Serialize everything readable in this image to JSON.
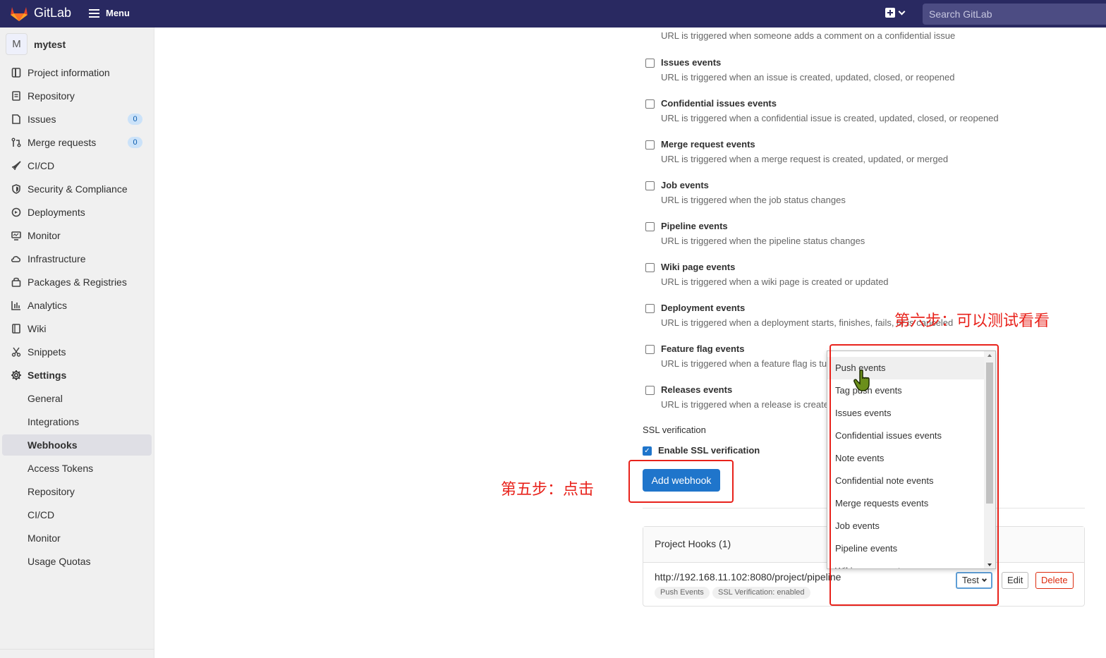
{
  "header": {
    "brand": "GitLab",
    "menu_label": "Menu",
    "search_placeholder": "Search GitLab"
  },
  "colors": {
    "topbar": "#292961",
    "primary": "#1f75cb",
    "danger": "#dd2b0e",
    "annotation": "#e8221b"
  },
  "sidebar": {
    "project_initial": "M",
    "project_name": "mytest",
    "items": [
      {
        "label": "Project information",
        "icon": "info-icon"
      },
      {
        "label": "Repository",
        "icon": "repository-icon"
      },
      {
        "label": "Issues",
        "icon": "issues-icon",
        "count": "0"
      },
      {
        "label": "Merge requests",
        "icon": "merge-request-icon",
        "count": "0"
      },
      {
        "label": "CI/CD",
        "icon": "rocket-icon"
      },
      {
        "label": "Security & Compliance",
        "icon": "shield-icon"
      },
      {
        "label": "Deployments",
        "icon": "deployments-icon"
      },
      {
        "label": "Monitor",
        "icon": "monitor-icon"
      },
      {
        "label": "Infrastructure",
        "icon": "cloud-icon"
      },
      {
        "label": "Packages & Registries",
        "icon": "package-icon"
      },
      {
        "label": "Analytics",
        "icon": "chart-icon"
      },
      {
        "label": "Wiki",
        "icon": "book-icon"
      },
      {
        "label": "Snippets",
        "icon": "scissors-icon"
      },
      {
        "label": "Settings",
        "icon": "gear-icon"
      }
    ],
    "settings_sub": [
      "General",
      "Integrations",
      "Webhooks",
      "Access Tokens",
      "Repository",
      "CI/CD",
      "Monitor",
      "Usage Quotas"
    ]
  },
  "events": {
    "partial_desc": "URL is triggered when someone adds a comment on a confidential issue",
    "items": [
      {
        "title": "Issues events",
        "desc": "URL is triggered when an issue is created, updated, closed, or reopened"
      },
      {
        "title": "Confidential issues events",
        "desc": "URL is triggered when a confidential issue is created, updated, closed, or reopened"
      },
      {
        "title": "Merge request events",
        "desc": "URL is triggered when a merge request is created, updated, or merged"
      },
      {
        "title": "Job events",
        "desc": "URL is triggered when the job status changes"
      },
      {
        "title": "Pipeline events",
        "desc": "URL is triggered when the pipeline status changes"
      },
      {
        "title": "Wiki page events",
        "desc": "URL is triggered when a wiki page is created or updated"
      },
      {
        "title": "Deployment events",
        "desc": "URL is triggered when a deployment starts, finishes, fails, or is canceled"
      },
      {
        "title": "Feature flag events",
        "desc": "URL is triggered when a feature flag is turned on or off"
      },
      {
        "title": "Releases events",
        "desc": "URL is triggered when a release is created or updated"
      }
    ]
  },
  "ssl": {
    "heading": "SSL verification",
    "checkbox_label": "Enable SSL verification",
    "checked": true
  },
  "add_button": "Add webhook",
  "hooks": {
    "heading": "Project Hooks (1)",
    "url": "http://192.168.11.102:8080/project/pipeline",
    "badges": [
      "Push Events",
      "SSL Verification: enabled"
    ],
    "test_label": "Test",
    "edit_label": "Edit",
    "delete_label": "Delete"
  },
  "test_dropdown": {
    "options": [
      "Push events",
      "Tag push events",
      "Issues events",
      "Confidential issues events",
      "Note events",
      "Confidential note events",
      "Merge requests events",
      "Job events",
      "Pipeline events",
      "Wiki page events"
    ],
    "hovered": "Push events"
  },
  "annotations": {
    "step5": "第五步：点击",
    "step6": "第六步：可以测试看看"
  }
}
